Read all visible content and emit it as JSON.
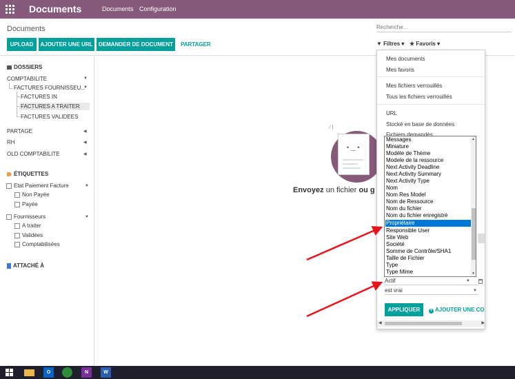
{
  "topbar": {
    "app_title": "Documents",
    "nav": [
      "Documents",
      "Configuration"
    ],
    "color": "#875a7b"
  },
  "control_panel": {
    "breadcrumb": "Documents",
    "search_placeholder": "Recherche...",
    "buttons": [
      "UPLOAD",
      "AJOUTER UNE URL",
      "DEMANDER DE DOCUMENT"
    ],
    "link": "PARTAGER",
    "filters_label": "Filtres",
    "favorites_label": "Favoris",
    "accent": "#00a09d"
  },
  "sidebar": {
    "folders_title": "DOSSIERS",
    "folders": [
      {
        "label": "COMPTABILITE"
      },
      {
        "label": "FACTURES FOURNISSEU..."
      },
      {
        "label": "FACTURES IN"
      },
      {
        "label": "FACTURES A TRAITER",
        "selected": true
      },
      {
        "label": "FACTURES VALIDEES"
      },
      {
        "label": "PARTAGE"
      },
      {
        "label": "RH"
      },
      {
        "label": "OLD COMPTABILITE"
      }
    ],
    "tags_title": "ÉTIQUETTES",
    "tags": [
      {
        "label": "Etat Paiement Facture"
      },
      {
        "label": "Non Payée"
      },
      {
        "label": "Payée"
      },
      {
        "label": "Fournisseurs"
      },
      {
        "label": "A traiter"
      },
      {
        "label": "Validées"
      },
      {
        "label": "Comptabilisées"
      }
    ],
    "attached_title": "ATTACHÉ À"
  },
  "main": {
    "empty_strong1": "Envoyez",
    "empty_text": " un fichier ",
    "empty_strong2": "ou g"
  },
  "filters_dropdown": {
    "group1": [
      "Mes documents",
      "Mes favoris"
    ],
    "group2": [
      "Mes fichiers verrouillés",
      "Tous les fichiers verrouillés"
    ],
    "group3": [
      "URL",
      "Stocké en base de données",
      "Fichiers demandés"
    ],
    "custom_field_value": "Actif",
    "custom_operator_value": "est vrai",
    "apply_label": "APPLIQUER",
    "add_condition_label": "AJOUTER UNE CON"
  },
  "field_listbox": {
    "options": [
      "Messages",
      "Miniature",
      "Modèle de Thème",
      "Modele de la ressource",
      "Next Activity Deadline",
      "Next Activity Summary",
      "Next Activity Type",
      "Nom",
      "Nom Res Model",
      "Nom de Ressource",
      "Nom du fichier",
      "Nom du fichier enregistré",
      "Propriétaire",
      "Responsible User",
      "Site Web",
      "Société",
      "Somme de Contrôle/SHA1",
      "Taille de Fichier",
      "Type",
      "Type Mime"
    ],
    "selected": "Propriétaire",
    "selected_color": "#0078d7"
  },
  "annotation_color": "#e8141b"
}
